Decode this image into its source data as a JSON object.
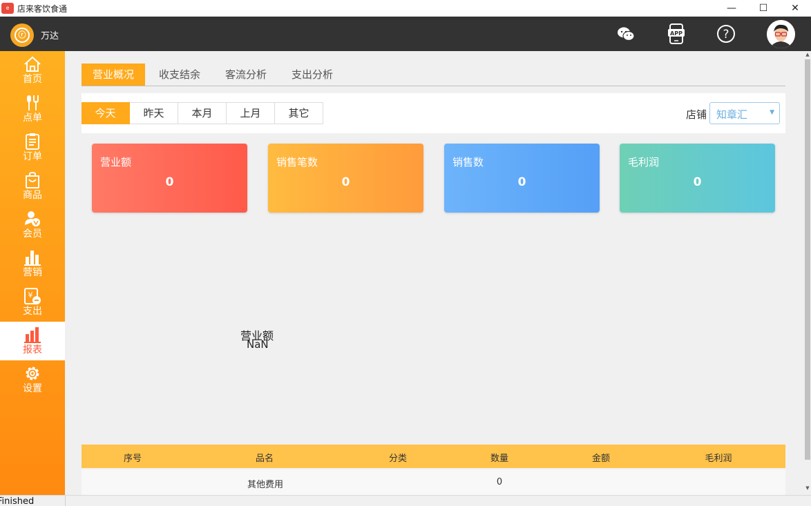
{
  "window": {
    "title": "店来客饮食通",
    "minimize": "—",
    "maximize": "☐",
    "close": "✕"
  },
  "header": {
    "store_name": "万达",
    "logo_glyph": "ⓡ",
    "icons": [
      "wechat-icon",
      "app-icon",
      "help-icon",
      "avatar"
    ],
    "app_label": "APP",
    "help_glyph": "?"
  },
  "sidebar": {
    "items": [
      {
        "label": "首页",
        "icon": "home-icon"
      },
      {
        "label": "点单",
        "icon": "utensils-icon"
      },
      {
        "label": "订单",
        "icon": "clipboard-icon"
      },
      {
        "label": "商品",
        "icon": "bag-icon"
      },
      {
        "label": "会员",
        "icon": "member-icon"
      },
      {
        "label": "营销",
        "icon": "bar-chart-icon"
      },
      {
        "label": "支出",
        "icon": "expense-icon"
      },
      {
        "label": "报表",
        "icon": "report-icon",
        "active": true
      },
      {
        "label": "设置",
        "icon": "gear-icon"
      }
    ]
  },
  "tabs": [
    "营业概况",
    "收支结余",
    "客流分析",
    "支出分析"
  ],
  "active_tab": "营业概况",
  "filters": {
    "periods": [
      "今天",
      "昨天",
      "本月",
      "上月",
      "其它"
    ],
    "active": "今天"
  },
  "store_filter": {
    "label": "店铺",
    "value": "知章汇"
  },
  "cards": [
    {
      "title": "营业额",
      "value": "0"
    },
    {
      "title": "销售笔数",
      "value": "0"
    },
    {
      "title": "销售数",
      "value": "0"
    },
    {
      "title": "毛利润",
      "value": "0"
    }
  ],
  "chart": {
    "title": "营业额",
    "value": "NaN"
  },
  "table": {
    "headers": [
      "序号",
      "品名",
      "分类",
      "数量",
      "金额",
      "毛利润"
    ],
    "rows": [
      {
        "index": "",
        "name": "其他费用",
        "category": "",
        "qty": "0",
        "amount": "",
        "profit": ""
      }
    ]
  },
  "status": {
    "text": "Finished"
  },
  "colors": {
    "accent": "#ffa91b",
    "header_bg": "#333333",
    "active_nav_text": "#ff5a3c"
  }
}
